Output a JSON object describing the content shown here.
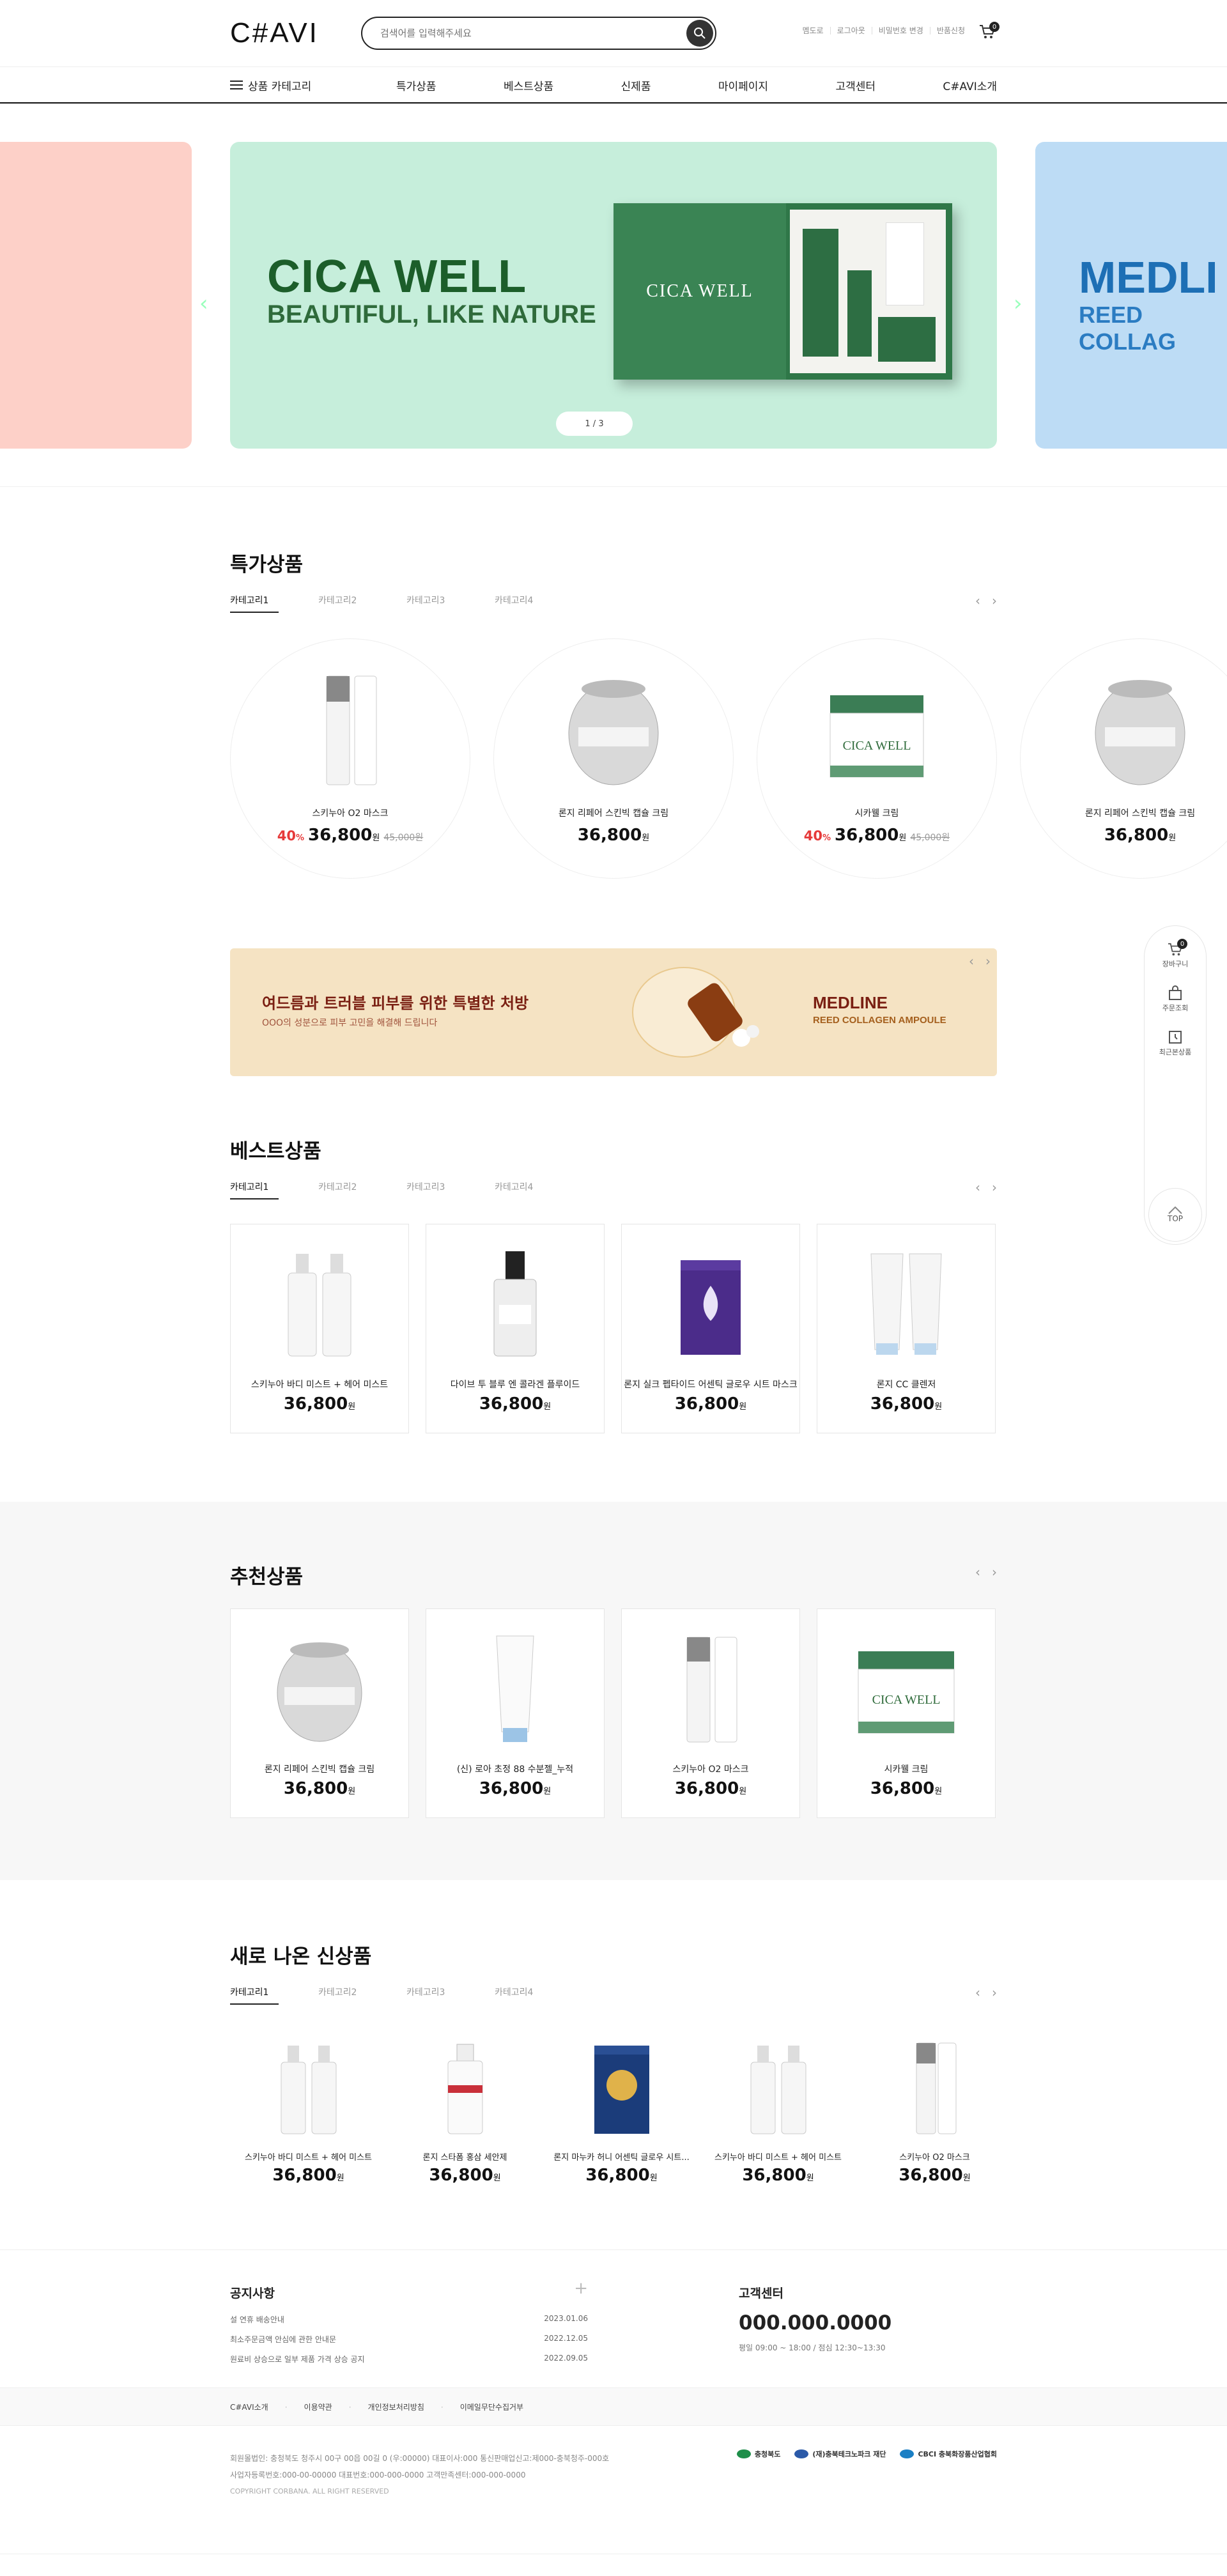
{
  "header": {
    "logo": "C#AVI",
    "search_placeholder": "검색어를 입력해주세요",
    "util_links": [
      "멤도로",
      "로그아웃",
      "비밀번호 변경",
      "반품신청"
    ],
    "cart_count": "0"
  },
  "gnb": {
    "category_label": "상품 카테고리",
    "menu": [
      "특가상품",
      "베스트상품",
      "신제품",
      "마이페이지",
      "고객센터",
      "C#AVI소개"
    ]
  },
  "hero": {
    "main_title": "CICA WELL",
    "main_sub": "BEAUTIFUL, LIKE NATURE",
    "box_label": "CICA WELL",
    "pager": "1 / 3",
    "right_title": "MEDLI",
    "right_sub": "REED COLLAG",
    "colors": {
      "left": "#fdd0c8",
      "main": "#c6eedb",
      "right": "#bddcf5"
    }
  },
  "special": {
    "title": "특가상품",
    "tabs": [
      "카테고리1",
      "카테고리2",
      "카테고리3",
      "카테고리4"
    ],
    "items": [
      {
        "name": "스키누아 O2 마스크",
        "discount": "40",
        "price": "36,800",
        "original": "45,000원"
      },
      {
        "name": "론지 리페어 스킨빅 캡슐 크림",
        "discount": "",
        "price": "36,800",
        "original": ""
      },
      {
        "name": "시카웰 크림",
        "discount": "40",
        "price": "36,800",
        "original": "45,000원"
      },
      {
        "name": "론지 리페어 스킨빅 캡슐 크림",
        "discount": "",
        "price": "36,800",
        "original": ""
      }
    ]
  },
  "promo": {
    "headline": "여드름과 트러블 피부를 위한 특별한 처방",
    "subline": "OOO의 성분으로 피부 고민을 해결해 드립니다",
    "brand": "MEDLINE",
    "brand_sub": "REED COLLAGEN AMPOULE"
  },
  "best": {
    "title": "베스트상품",
    "tabs": [
      "카테고리1",
      "카테고리2",
      "카테고리3",
      "카테고리4"
    ],
    "items": [
      {
        "name": "스키누아 바디 미스트 + 헤어 미스트",
        "price": "36,800"
      },
      {
        "name": "다이브 투 블루 엔 콜라겐 플루이드",
        "price": "36,800"
      },
      {
        "name": "론지 실크 펩타이드 어센틱 글로우 시트 마스크",
        "price": "36,800"
      },
      {
        "name": "론지 CC 클렌저",
        "price": "36,800"
      }
    ]
  },
  "recommend": {
    "title": "추천상품",
    "items": [
      {
        "name": "론지 리페어 스킨빅 캡슐 크림",
        "price": "36,800"
      },
      {
        "name": "(신) 로아 초정 88 수분젤_누적",
        "price": "36,800"
      },
      {
        "name": "스키누아 O2 마스크",
        "price": "36,800"
      },
      {
        "name": "시카웰 크림",
        "price": "36,800"
      }
    ]
  },
  "newarrivals": {
    "title": "새로 나온 신상품",
    "tabs": [
      "카테고리1",
      "카테고리2",
      "카테고리3",
      "카테고리4"
    ],
    "items": [
      {
        "name": "스키누아 바디 미스트 + 헤어 미스트",
        "price": "36,800"
      },
      {
        "name": "론지 스타폼 홍삼 세안제",
        "price": "36,800"
      },
      {
        "name": "론지 마누카 허니 어센틱 글로우 시트...",
        "price": "36,800"
      },
      {
        "name": "스키누아 바디 미스트 + 헤어 미스트",
        "price": "36,800"
      },
      {
        "name": "스키누아 O2 마스크",
        "price": "36,800"
      }
    ]
  },
  "quick": {
    "cart_label": "장바구니",
    "cart_count": "0",
    "order_label": "주문조회",
    "recent_label": "최근본상품",
    "top_label": "TOP"
  },
  "currency": "원",
  "discount_unit": "%",
  "footer": {
    "notice_title": "공지사항",
    "notices": [
      {
        "title": "설 연휴 배송안내",
        "date": "2023.01.06"
      },
      {
        "title": "최소주문금액 안심에 관한 안내문",
        "date": "2022.12.05"
      },
      {
        "title": "원료비 상승으로 일부 제품 가격 상승 공지",
        "date": "2022.09.05"
      }
    ],
    "cs_title": "고객센터",
    "cs_tel": "000.000.0000",
    "cs_hours": "평일 09:00 ~ 18:00 / 점심 12:30~13:30",
    "links": [
      "C#AVI소개",
      "이용약관",
      "개인정보처리방침",
      "이메일무단수집거부"
    ],
    "info1": "회원몰법인: 충청북도 청주시 00구 00읍 00길 0 (우:00000)     대표이사:000     통신판매업신고:제000-충북청주-000호",
    "info2": "사업자등록번호:000-00-00000     대표번호:000-000-0000     고객만족센터:000-000-0000",
    "copyright": "COPYRIGHT CORBANA. ALL RIGHT RESERVED",
    "partner_logos": [
      "충청북도",
      "(재)충북테크노파크 재단",
      "CBCI 충북화장품산업협회"
    ]
  }
}
